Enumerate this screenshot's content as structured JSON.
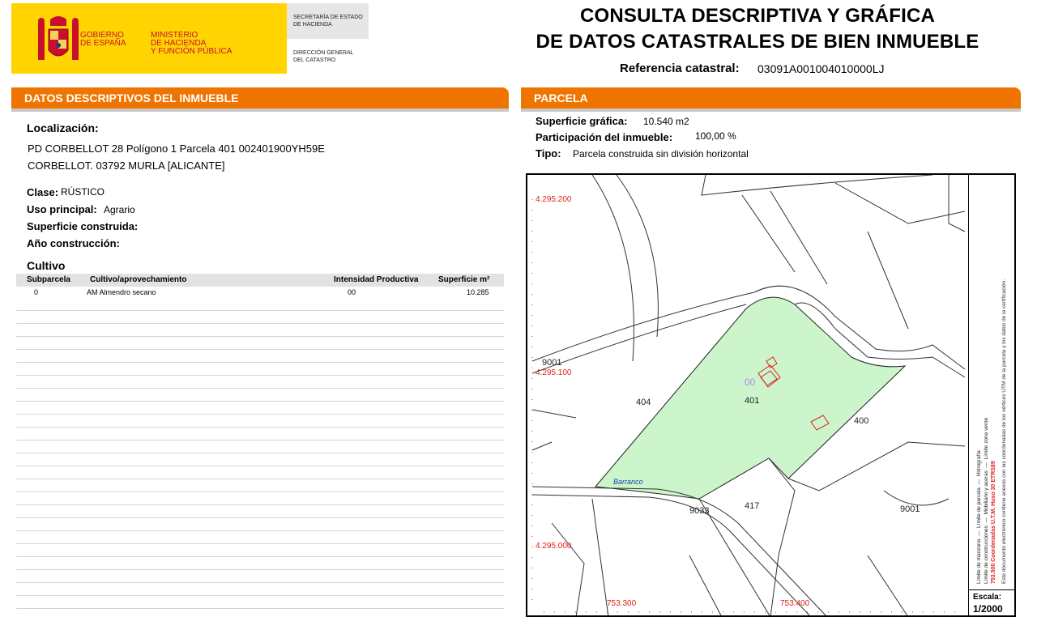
{
  "header": {
    "gobierno": [
      "GOBIERNO",
      "DE ESPAÑA"
    ],
    "ministerio": [
      "MINISTERIO",
      "DE HACIENDA",
      "Y FUNCIÓN PÚBLICA"
    ],
    "secretaria": [
      "SECRETARÍA DE ESTADO",
      "DE HACIENDA"
    ],
    "direccion": [
      "DIRECCIÓN GENERAL",
      "DEL CATASTRO"
    ],
    "title_line1": "CONSULTA DESCRIPTIVA Y GRÁFICA",
    "title_line2": "DE DATOS CATASTRALES DE BIEN INMUEBLE",
    "ref_label": "Referencia catastral:",
    "ref_value": "03091A001004010000LJ",
    "brand_yellow": "#ffd400",
    "brand_red": "#c8102e"
  },
  "left": {
    "bar_title_prefix": "DATOS DESCRIPTIVOS DEL ",
    "bar_title_bold": "INMUEBLE",
    "localizacion_label": "Localización:",
    "address_line1": "PD CORBELLOT 28 Polígono 1 Parcela 401 002401900YH59E",
    "address_line2": "CORBELLOT. 03792 MURLA [ALICANTE]",
    "clase_label": "Clase:",
    "clase_value": "RÚSTICO",
    "uso_label": "Uso principal:",
    "uso_value": "Agrario",
    "superficie_label": "Superficie construida:",
    "anio_label": "Año construcción:",
    "cultivo_title": "Cultivo",
    "table": {
      "headers": [
        "Subparcela",
        "Cultivo/aprovechamiento",
        "Intensidad Productiva",
        "Superficie m²"
      ],
      "rows": [
        [
          "0",
          "AM Almendro secano",
          "00",
          "10.285"
        ]
      ]
    }
  },
  "right": {
    "bar_title": "PARCELA",
    "superficie_grafica_label": "Superficie gráfica:",
    "superficie_grafica_value": "10.540 m2",
    "participacion_label": "Participación del inmueble:",
    "participacion_value": "100,00 %",
    "tipo_label": "Tipo:",
    "tipo_value": "Parcela construida sin división horizontal"
  },
  "map": {
    "coord_labels": [
      "4.295.200",
      "4.295.100",
      "4.295.000",
      "753.300",
      "753.400"
    ],
    "parcel_numbers": [
      "9001",
      "404",
      "401",
      "400",
      "417",
      "9033",
      "9001"
    ],
    "overlay_label": "00",
    "barranco_label": "Barranco",
    "legend_rows": [
      "Límite de parcela",
      "Mobiliario y aceras",
      "Límite de manzana",
      "Límite de construcciones",
      "Hidrografía",
      "Límite zona verde"
    ],
    "legend_red": "753.500 Coordenadas U.T.M. Huso 30 ETRS89",
    "legend_note": "Este documento electrónico contiene anexos con las coordenadas de los vértices UTM de la parcela y los datos de la certificación.",
    "scale_label": "Escala:",
    "scale_value": "1/2000",
    "parcel_fill": "#ccf5cc",
    "coord_color": "#e0201a"
  },
  "accent_orange": "#f07400"
}
